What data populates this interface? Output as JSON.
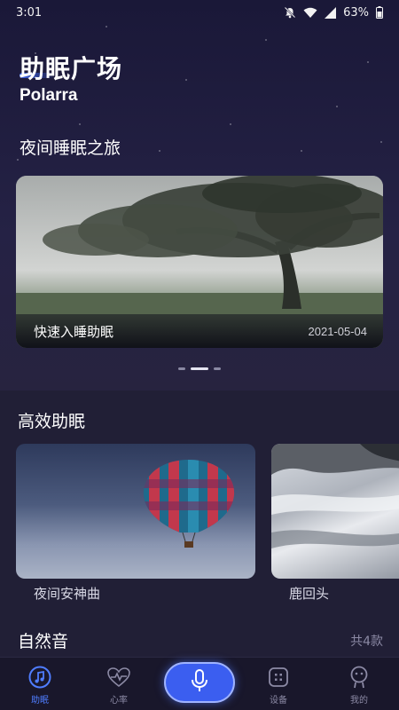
{
  "status_bar": {
    "time": "3:01",
    "battery": "63%"
  },
  "header": {
    "title": "助眠广场",
    "subtitle": "Polarra"
  },
  "night_journey": {
    "section_title": "夜间睡眠之旅",
    "banner": {
      "label": "快速入睡助眠",
      "date": "2021-05-04"
    },
    "pager": {
      "total": 3,
      "active_index": 1
    }
  },
  "efficient_sleep": {
    "section_title": "高效助眠",
    "cards": [
      {
        "label": "夜间安神曲",
        "image": "hot-air-balloon"
      },
      {
        "label": "鹿回头",
        "image": "snowy-landscape"
      }
    ]
  },
  "nature_sounds": {
    "section_title": "自然音",
    "count": "共4款"
  },
  "tab_bar": {
    "tabs": [
      {
        "label": "助眠",
        "icon": "music-note-icon",
        "active": true
      },
      {
        "label": "心率",
        "icon": "heart-rate-icon",
        "active": false
      },
      {
        "label": "",
        "icon": "microphone-icon",
        "active": false
      },
      {
        "label": "设备",
        "icon": "device-icon",
        "active": false
      },
      {
        "label": "我的",
        "icon": "profile-icon",
        "active": false
      }
    ]
  },
  "colors": {
    "accent": "#3b5ef0",
    "background": "#1f1d35",
    "tab_inactive": "#8c8aa5"
  }
}
